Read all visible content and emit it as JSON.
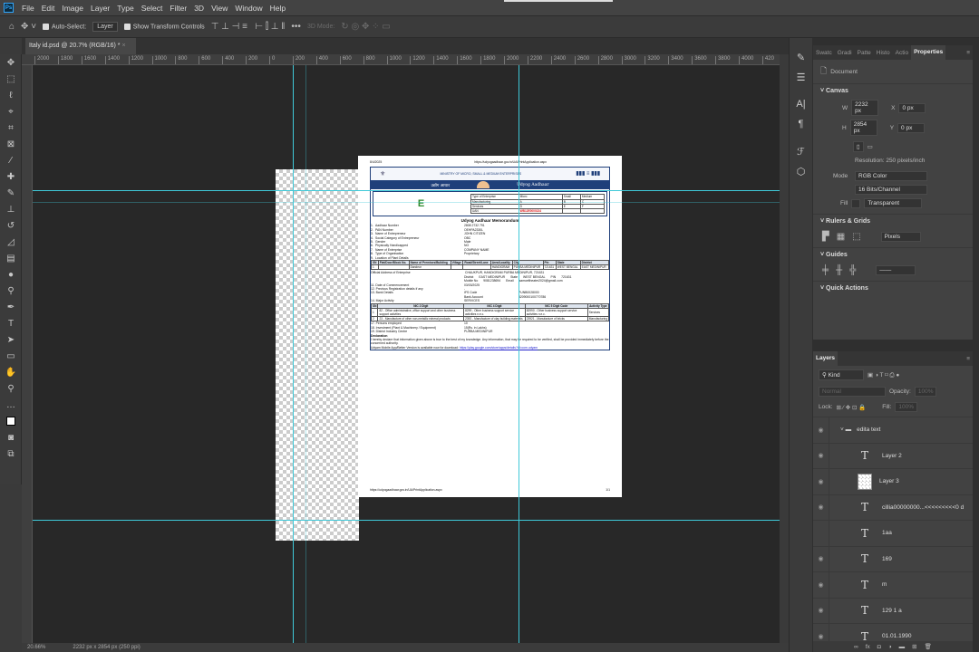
{
  "menu": {
    "items": [
      "File",
      "Edit",
      "Image",
      "Layer",
      "Type",
      "Select",
      "Filter",
      "3D",
      "View",
      "Window",
      "Help"
    ]
  },
  "options": {
    "auto_select": "Auto-Select:",
    "auto_select_target": "Layer",
    "show_transform": "Show Transform Controls",
    "mode_3d": "3D Mode:"
  },
  "tab": {
    "title": "Italy id.psd @ 20.7% (RGB/16) *"
  },
  "hruler": [
    "2000",
    "1800",
    "1600",
    "1400",
    "1200",
    "1000",
    "800",
    "600",
    "400",
    "200",
    "0",
    "200",
    "400",
    "600",
    "800",
    "1000",
    "1200",
    "1400",
    "1600",
    "1800",
    "2000",
    "2200",
    "2400",
    "2600",
    "2800",
    "3000",
    "3200",
    "3400",
    "3600",
    "3800",
    "4000",
    "420"
  ],
  "status": {
    "zoom": "20.66%",
    "size": "2232 px x 2854 px (250 ppi)"
  },
  "properties": {
    "tabs": [
      "Swatc",
      "Gradi",
      "Patte",
      "Histo",
      "Actio",
      "Properties"
    ],
    "doc_label": "Document",
    "canvas": "Canvas",
    "w_label": "W",
    "w": "2232 px",
    "h_label": "H",
    "h": "2854 px",
    "x_label": "X",
    "x": "0 px",
    "y_label": "Y",
    "y": "0 px",
    "resolution": "Resolution: 250 pixels/inch",
    "mode_label": "Mode",
    "mode": "RGB Color",
    "depth": "16 Bits/Channel",
    "fill_label": "Fill",
    "fill": "Transparent",
    "rulers": "Rulers & Grids",
    "units": "Pixels",
    "guides": "Guides",
    "quick": "Quick Actions"
  },
  "layers": {
    "title": "Layers",
    "kind": "Kind",
    "blend": "Normal",
    "opacity_label": "Opacity:",
    "opacity": "100%",
    "lock_label": "Lock:",
    "fill_label": "Fill:",
    "fill": "100%",
    "items": [
      {
        "name": "edita text",
        "type": "group"
      },
      {
        "name": "Layer 2",
        "type": "text"
      },
      {
        "name": "Layer 3",
        "type": "pixel"
      },
      {
        "name": "cillia00000000...<<<<<<<<<0 d",
        "type": "text"
      },
      {
        "name": "1aa",
        "type": "text"
      },
      {
        "name": "169",
        "type": "text"
      },
      {
        "name": "m",
        "type": "text"
      },
      {
        "name": "129 1 a",
        "type": "text"
      },
      {
        "name": "01.01.1990",
        "type": "text"
      }
    ]
  },
  "doc": {
    "date": "8/4/2025",
    "url": "https://udyogaadhaar.gov.in/UA/PrintApplication.aspx",
    "ministry": "MINISTRY OF MICRO, SMALL & MEDIUM ENTERPRISES",
    "hindi": "उद्योग आधार",
    "banner": "Udyog Aadhaar",
    "grade": "E",
    "type_table": [
      [
        "Type of Enterprise",
        "Micro",
        "Small",
        "Medium"
      ],
      [
        "Manufacturing",
        "A",
        "B",
        "C"
      ],
      [
        "Services",
        "D",
        "E",
        "F"
      ],
      [
        "UAN",
        "WB12E0000224",
        "",
        " "
      ]
    ],
    "title": "Udyog Aadhaar Memorandum",
    "fields": [
      [
        "1.",
        "Aadhaar Number",
        "2808 2732 791"
      ],
      [
        "2.",
        "PAN Number",
        "OEHPA2330L"
      ],
      [
        "3.",
        "Name of Entrepreneur",
        "JOHN CITIZEN"
      ],
      [
        "4.",
        "Social Category of Entrepreneur",
        "OBC"
      ],
      [
        "5.",
        "Gender",
        "Male"
      ],
      [
        "6.",
        "Physically Handicapped",
        "NO"
      ],
      [
        "7.",
        "Name of Enterprise",
        "COMPANY NAME"
      ],
      [
        "8.",
        "Type of Organisation",
        "Proprietary"
      ],
      [
        "9.",
        "Location of Plant Details",
        ""
      ]
    ],
    "loc_head": [
      "SN",
      "Flat/Door/Block No.",
      "Name of Premises/Building",
      "Village",
      "Road/Street/Lane",
      "Area/Locality",
      "City",
      "Pin",
      "State",
      "District"
    ],
    "loc_row": [
      "1",
      "",
      "Dandeur",
      "",
      "",
      "HANDIGRAM",
      "PURBA MEDINIPUR",
      "721631",
      "WEST BENGAL",
      "EAST MEDINIPUR"
    ],
    "addr_label": "Official Address of Enterprise",
    "addr": "CHAUKPUR, HANDIGRAM PURBA MEDINIPUR, 721631",
    "district_label": "District",
    "district": "EAST MEDINIPUR",
    "state_label": "State",
    "state": "WEST BENGAL",
    "pin_label": "PIN",
    "pin": "721631",
    "mobile_label": "Mobile No",
    "mobile": "9081238694",
    "email_label": "Email",
    "email": "samueltheater2024@gmail.com",
    "doc_label": "11. Date of Commencement",
    "doc_val": "03/03/2025",
    "prev_label": "12. Previous Registration details if any",
    "prev_val": "-",
    "bank_label": "13. Bank Details",
    "ifs_label": "IFS Code",
    "ifs": "PUNB0028000",
    "acct_label": "Bank Account",
    "acct": "3209000100770786",
    "major_label": "14. Major Activity",
    "major": "SERVICES",
    "nic_head": [
      "SN",
      "NIC 2 Digit",
      "NIC 4 Digit",
      "NIC 5 Digit Code",
      "Activity Type"
    ],
    "nic_rows": [
      [
        "1",
        "82 - Office administrative, office support and other business support activities",
        "8299 - Other business support service activities n.e.c.",
        "82990 - Other business support service activities n.e.c.",
        "Services"
      ],
      [
        "2",
        "23 - Manufacture of other non-metallic mineral products",
        "2392 - Manufacture of clay building materials",
        "23921 - Manufacture of bricks",
        "Manufacturing"
      ]
    ],
    "persons_label": "17. Persons employed",
    "persons": "10",
    "invest_label": "18. Investment (Plant & Machinery / Equipment)",
    "invest": "15(Rs. in Lakhs)",
    "dic_label": "19. District Industry Centre",
    "dic": "PURBA MEDINIPUR",
    "decl_title": "Declaration",
    "decl": "I hereby declare that information given above is true to the best of my knowledge. Any information, that may be required to be verified, shall be provided immediately before the concerned authority.",
    "app_note": "Udyam Mobile App/Better Version is available now for download:",
    "app_link": "https://play.google.com/store/apps/details?id=com.udyam",
    "footer_url": "https://udyogaadhaar.gov.in/UA/PrintApplication.aspx",
    "footer_page": "1/1"
  }
}
